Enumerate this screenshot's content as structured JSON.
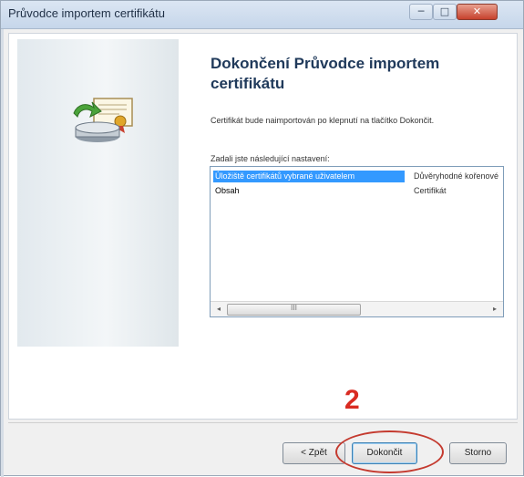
{
  "window": {
    "title": "Průvodce importem certifikátu",
    "controls": {
      "minimize": "─",
      "maximize": "□",
      "close": "✕"
    }
  },
  "wizard": {
    "heading": "Dokončení Průvodce importem certifikátu",
    "description": "Certifikát bude naimportován po klepnutí na tlačítko Dokončit.",
    "settings_label": "Zadali jste následující nastavení:",
    "settings": [
      {
        "name": "Úložiště certifikátů vybrané uživatelem",
        "value": "Důvěryhodné kořenové",
        "selected": true
      },
      {
        "name": "Obsah",
        "value": "Certifikát",
        "selected": false
      }
    ],
    "scrollbar": {
      "left_arrow": "◂",
      "right_arrow": "▸",
      "thumb_grip": "III"
    },
    "icon": "certificate-import-icon"
  },
  "annotation": {
    "step_number": "2",
    "color": "#d92b22"
  },
  "buttons": {
    "back": "< Zpět",
    "finish": "Dokončit",
    "cancel": "Storno"
  }
}
